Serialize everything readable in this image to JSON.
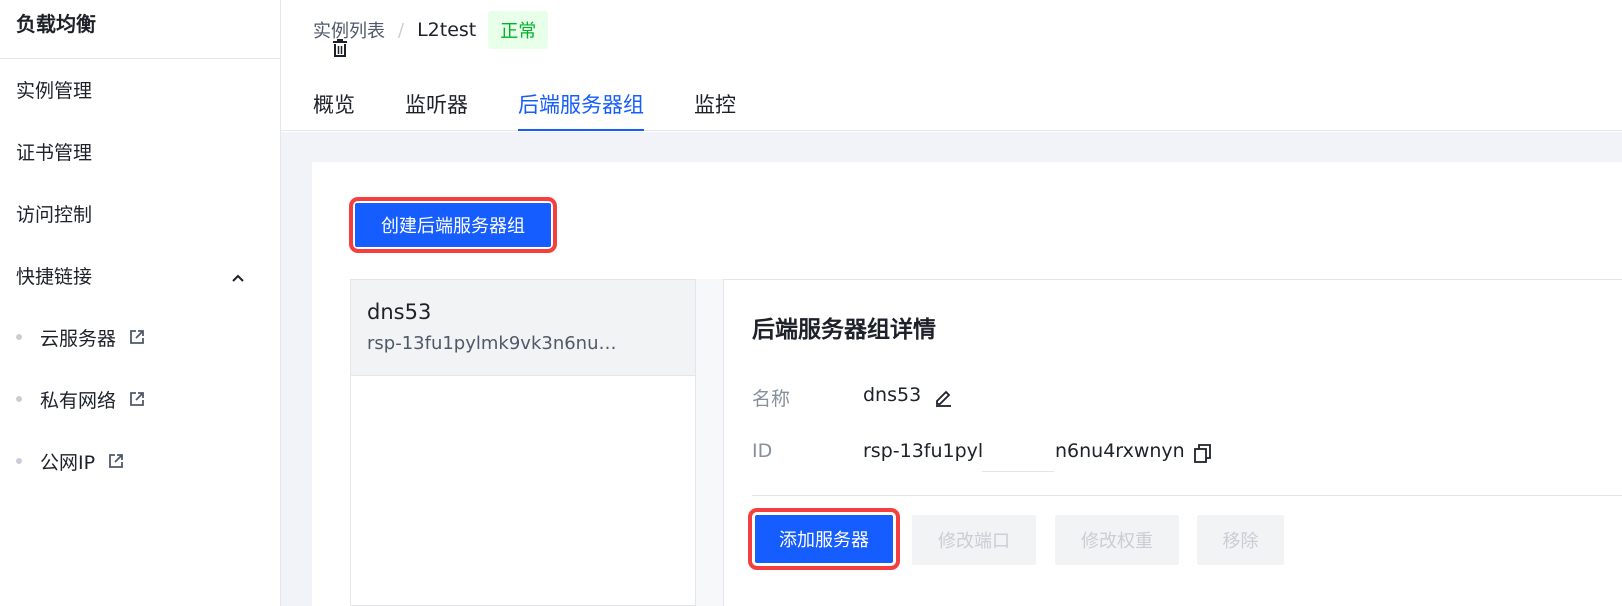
{
  "sidebar": {
    "title": "负载均衡",
    "items": [
      {
        "label": "实例管理"
      },
      {
        "label": "证书管理"
      },
      {
        "label": "访问控制"
      },
      {
        "label": "快捷链接"
      }
    ],
    "quick_links": [
      {
        "label": "云服务器",
        "icon": "external-link-icon"
      },
      {
        "label": "私有网络",
        "icon": "external-link-icon"
      },
      {
        "label": "公网IP",
        "icon": "external-link-icon"
      }
    ]
  },
  "breadcrumb": {
    "parent": "实例列表",
    "separator": "/",
    "current": "L2test",
    "status": "正常"
  },
  "tabs": [
    {
      "label": "概览"
    },
    {
      "label": "监听器"
    },
    {
      "label": "后端服务器组",
      "active": true
    },
    {
      "label": "监控"
    }
  ],
  "toolbar": {
    "create_label": "创建后端服务器组"
  },
  "server_groups": [
    {
      "name": "dns53",
      "id": "rsp-13fu1pylmk9vk3n6nu4rxwnyn"
    }
  ],
  "detail": {
    "title": "后端服务器组详情",
    "name_label": "名称",
    "name_value": "dns53",
    "id_label": "ID",
    "id_value": "rsp-13fu1pylmk9vk3n6nu4rxwnyn",
    "id_prefix_visible": "rsp-13fu1pyl",
    "id_suffix_visible": "n6nu4rxwnyn"
  },
  "actions": {
    "add_label": "添加服务器",
    "modify_port_label": "修改端口",
    "modify_weight_label": "修改权重",
    "remove_label": "移除"
  },
  "colors": {
    "primary": "#165dff",
    "highlight": "#f53f3f",
    "status_green": "#00b42a"
  }
}
